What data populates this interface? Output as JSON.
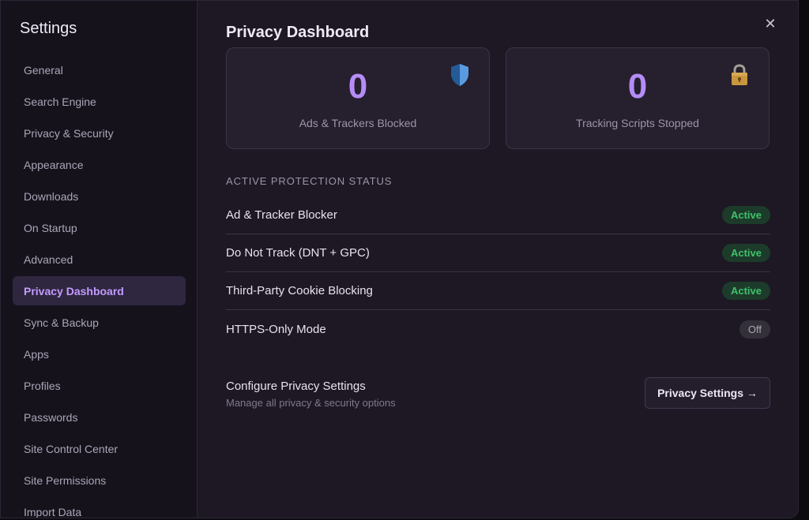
{
  "sidebar": {
    "title": "Settings",
    "items": [
      {
        "label": "General"
      },
      {
        "label": "Search Engine"
      },
      {
        "label": "Privacy & Security"
      },
      {
        "label": "Appearance"
      },
      {
        "label": "Downloads"
      },
      {
        "label": "On Startup"
      },
      {
        "label": "Advanced"
      },
      {
        "label": "Privacy Dashboard",
        "active": true
      },
      {
        "label": "Sync & Backup"
      },
      {
        "label": "Apps"
      },
      {
        "label": "Profiles"
      },
      {
        "label": "Passwords"
      },
      {
        "label": "Site Control Center"
      },
      {
        "label": "Site Permissions"
      },
      {
        "label": "Import Data"
      }
    ]
  },
  "close_label": "✕",
  "main": {
    "title": "Privacy Dashboard",
    "stats": [
      {
        "value": "0",
        "label": "Ads & Trackers Blocked",
        "icon": "shield-icon"
      },
      {
        "value": "0",
        "label": "Tracking Scripts Stopped",
        "icon": "lock-icon"
      }
    ],
    "section_label": "ACTIVE PROTECTION STATUS",
    "protections": [
      {
        "name": "Ad & Tracker Blocker",
        "status": "Active"
      },
      {
        "name": "Do Not Track (DNT + GPC)",
        "status": "Active"
      },
      {
        "name": "Third-Party Cookie Blocking",
        "status": "Active"
      },
      {
        "name": "HTTPS-Only Mode",
        "status": "Off"
      }
    ],
    "configure": {
      "title": "Configure Privacy Settings",
      "subtitle": "Manage all privacy & security options",
      "button_label": "Privacy Settings →"
    }
  },
  "colors": {
    "accent": "#b58cf7",
    "active_green": "#3ec26b",
    "background": "#1d1824"
  }
}
